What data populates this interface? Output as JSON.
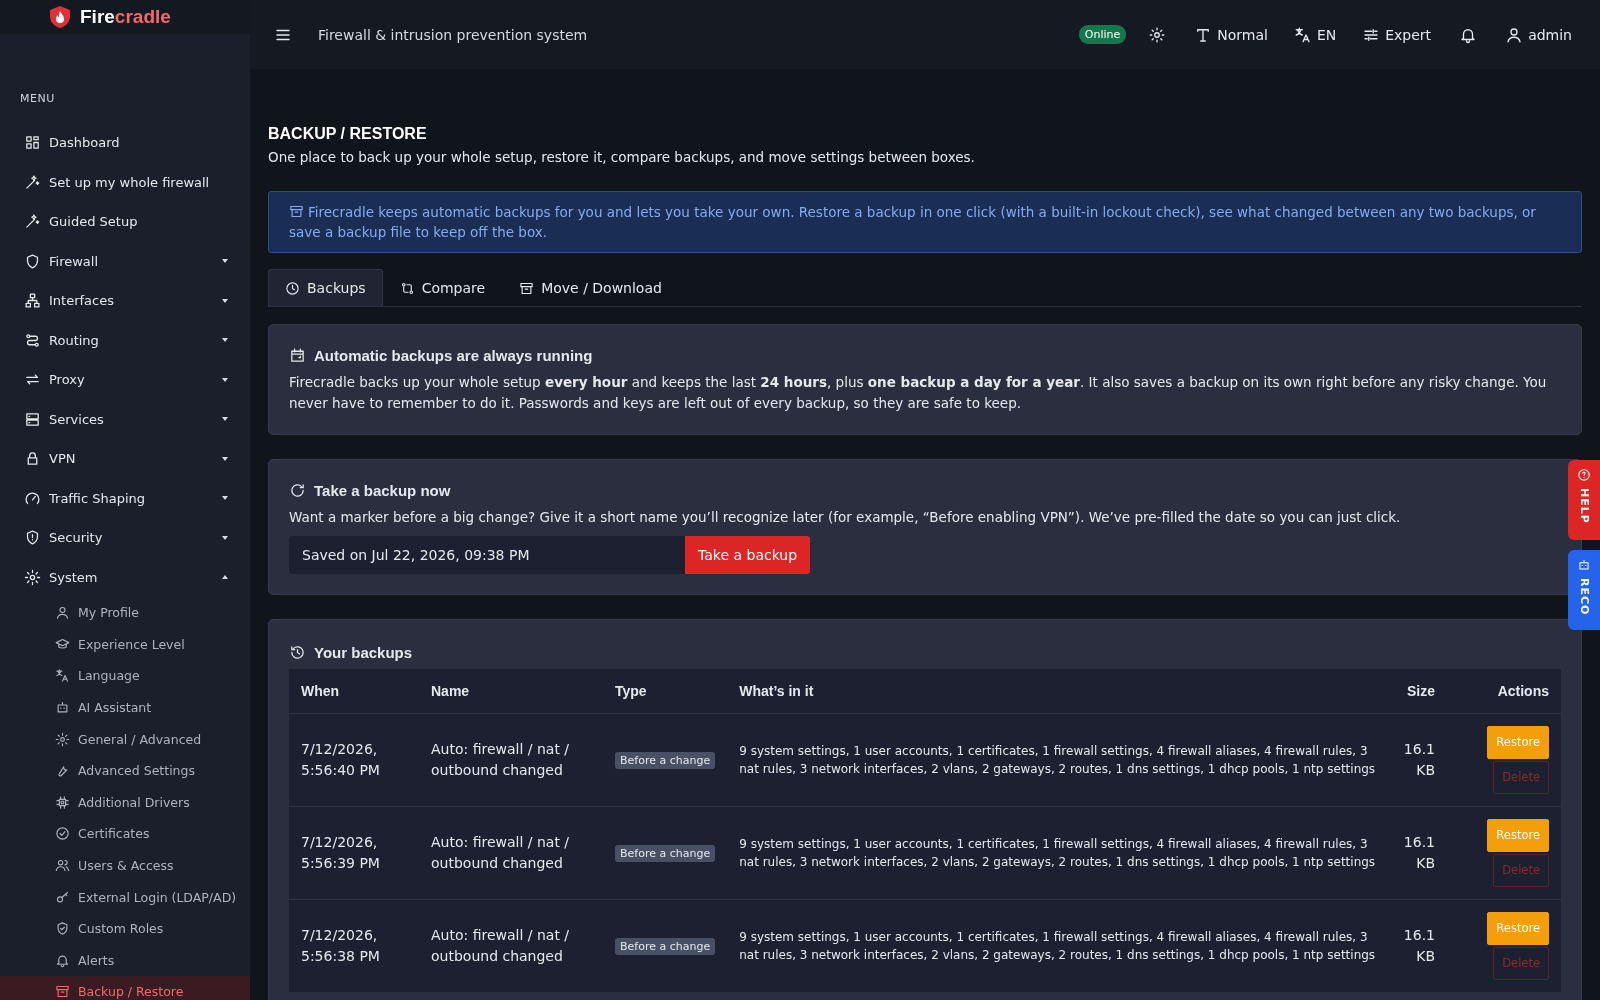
{
  "brand": {
    "name_start": "Fire",
    "name_end": "cradle"
  },
  "sidebar": {
    "heading": "MENU",
    "items": [
      {
        "label": "Dashboard",
        "kind": "link"
      },
      {
        "label": "Set up my whole firewall",
        "kind": "link"
      },
      {
        "label": "Guided Setup",
        "kind": "link"
      },
      {
        "label": "Firewall",
        "kind": "group",
        "expanded": false
      },
      {
        "label": "Interfaces",
        "kind": "group",
        "expanded": false
      },
      {
        "label": "Routing",
        "kind": "group",
        "expanded": false
      },
      {
        "label": "Proxy",
        "kind": "group",
        "expanded": false
      },
      {
        "label": "Services",
        "kind": "group",
        "expanded": false
      },
      {
        "label": "VPN",
        "kind": "group",
        "expanded": false
      },
      {
        "label": "Traffic Shaping",
        "kind": "group",
        "expanded": false
      },
      {
        "label": "Security",
        "kind": "group",
        "expanded": false
      },
      {
        "label": "System",
        "kind": "group",
        "expanded": true,
        "children": [
          {
            "label": "My Profile",
            "selected": false
          },
          {
            "label": "Experience Level",
            "selected": false
          },
          {
            "label": "Language",
            "selected": false
          },
          {
            "label": "AI Assistant",
            "selected": false
          },
          {
            "label": "General / Advanced",
            "selected": false
          },
          {
            "label": "Advanced Settings",
            "selected": false
          },
          {
            "label": "Additional Drivers",
            "selected": false
          },
          {
            "label": "Certificates",
            "selected": false
          },
          {
            "label": "Users & Access",
            "selected": false
          },
          {
            "label": "External Login (LDAP/AD)",
            "selected": false
          },
          {
            "label": "Custom Roles",
            "selected": false
          },
          {
            "label": "Alerts",
            "selected": false
          },
          {
            "label": "Backup / Restore",
            "selected": true
          }
        ]
      }
    ]
  },
  "topbar": {
    "title": "Firewall & intrusion prevention system",
    "status": "Online",
    "text_size": "Normal",
    "language": "EN",
    "mode": "Expert",
    "user": "admin"
  },
  "page": {
    "title": "BACKUP / RESTORE",
    "subtitle": "One place to back up your whole setup, restore it, compare backups, and move settings between boxes.",
    "info": "Firecradle keeps automatic backups for you and lets you take your own. Restore a backup in one click (with a built-in lockout check), see what changed between any two backups, or save a backup file to keep off the box."
  },
  "tabs": [
    {
      "label": "Backups",
      "selected": true
    },
    {
      "label": "Compare",
      "selected": false
    },
    {
      "label": "Move / Download",
      "selected": false
    }
  ],
  "auto_card": {
    "title": "Automatic backups are always running",
    "text": "Firecradle backs up your whole setup **every hour** and keeps the last **24 hours**, plus **one backup a day for a year**. It also saves a backup on its own right before any risky change. You never have to remember to do it. Passwords and keys are left out of every backup, so they are safe to keep."
  },
  "take_card": {
    "title": "Take a backup now",
    "text": "Want a marker before a big change? Give it a short name you’ll recognize later (for example, “Before enabling VPN”). We’ve pre-filled the date so you can just click.",
    "name_value": "Saved on Jul 22, 2026, 09:38 PM",
    "button": "Take a backup"
  },
  "backups": {
    "title": "Your backups",
    "columns": [
      "When",
      "Name",
      "Type",
      "What’s in it",
      "Size",
      "Actions"
    ],
    "rows": [
      {
        "when": "7/12/2026, 5:56:40 PM",
        "name": "Auto: firewall / nat / outbound changed",
        "type": "Before a change",
        "contents": "9 system settings, 1 user accounts, 1 certificates, 1 firewall settings, 4 firewall aliases, 4 firewall rules, 3 nat rules, 3 network interfaces, 2 vlans, 2 gateways, 2 routes, 1 dns settings, 1 dhcp pools, 1 ntp settings",
        "size": "16.1 KB",
        "actions": [
          {
            "label": "Restore",
            "kind": "restore"
          },
          {
            "label": "Delete",
            "kind": "delete"
          }
        ]
      },
      {
        "when": "7/12/2026, 5:56:39 PM",
        "name": "Auto: firewall / nat / outbound changed",
        "type": "Before a change",
        "contents": "9 system settings, 1 user accounts, 1 certificates, 1 firewall settings, 4 firewall aliases, 4 firewall rules, 3 nat rules, 3 network interfaces, 2 vlans, 2 gateways, 2 routes, 1 dns settings, 1 dhcp pools, 1 ntp settings",
        "size": "16.1 KB",
        "actions": [
          {
            "label": "Restore",
            "kind": "restore"
          },
          {
            "label": "Delete",
            "kind": "delete"
          }
        ]
      },
      {
        "when": "7/12/2026, 5:56:38 PM",
        "name": "Auto: firewall / nat / outbound changed",
        "type": "Before a change",
        "contents": "9 system settings, 1 user accounts, 1 certificates, 1 firewall settings, 4 firewall aliases, 4 firewall rules, 3 nat rules, 3 network interfaces, 2 vlans, 2 gateways, 2 routes, 1 dns settings, 1 dhcp pools, 1 ntp settings",
        "size": "16.1 KB",
        "actions": [
          {
            "label": "Restore",
            "kind": "restore"
          },
          {
            "label": "Delete",
            "kind": "delete"
          }
        ]
      }
    ]
  },
  "side_tabs": [
    {
      "label": "HELP",
      "kind": "help"
    },
    {
      "label": "RECO",
      "kind": "reco"
    }
  ]
}
